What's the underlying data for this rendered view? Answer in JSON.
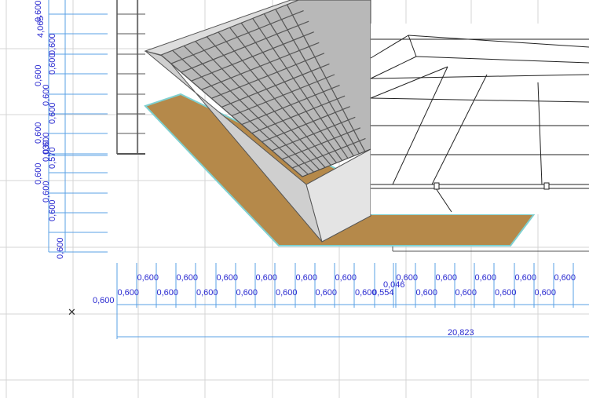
{
  "app": "CAD floor plan / 3D view",
  "colors": {
    "dimension_line": "#5aa0e6",
    "dimension_text": "#2a2ad0",
    "grid": "#d4d4d4",
    "roof_tile": "#9a9a9a",
    "slab": "#b5894a",
    "slab_edge": "#7fd0d0"
  },
  "vertical_dimensions": [
    "0,600",
    "4,065",
    "0,600",
    "0,600",
    "0,600",
    "0,600",
    "0,600",
    "0,600",
    "0,600",
    "0,030",
    "0,570",
    "0,600",
    "0,600",
    "0,600",
    "0,600"
  ],
  "horizontal_dimensions": [
    "0,600",
    "0,600",
    "0,600",
    "0,600",
    "0,600",
    "0,600",
    "0,600",
    "0,600",
    "0,600",
    "0,600",
    "0,600",
    "0,600",
    "0,600",
    "0,600",
    "0,554",
    "0,046",
    "0,600",
    "0,600",
    "0,600",
    "0,600",
    "0,600",
    "0,600",
    "0,600",
    "0,600",
    "0,600"
  ],
  "total_dimension": "20,823",
  "marker_icon": "cross-marker-icon"
}
